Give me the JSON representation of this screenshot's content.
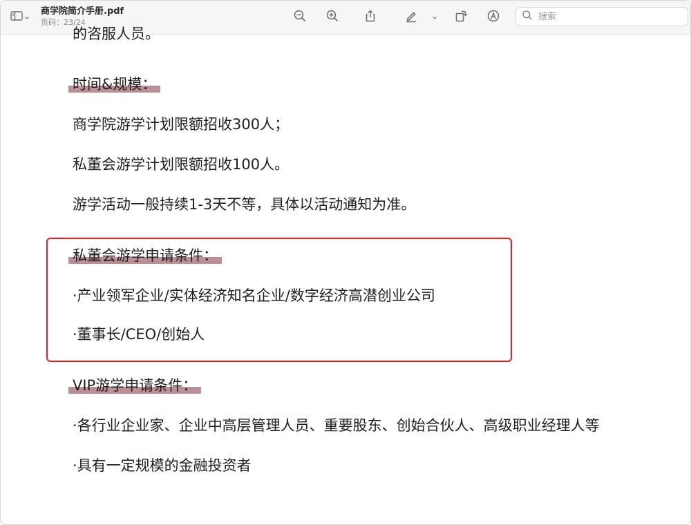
{
  "toolbar": {
    "title": "商学院简介手册.pdf",
    "page_info": "页码：23/24",
    "search_placeholder": "搜索",
    "icons": [
      "sidebar-icon",
      "chevron-down-icon",
      "zoom-out-icon",
      "zoom-in-icon",
      "share-icon",
      "highlight-pen-icon",
      "chevron-down-icon",
      "rotate-icon",
      "markup-icon",
      "search-icon"
    ]
  },
  "document": {
    "cut_line": "的咨服人员。",
    "section1_heading": "时间&规模：",
    "section1_lines": [
      "商学院游学计划限额招收300人；",
      "私董会游学计划限额招收100人。",
      "游学活动一般持续1-3天不等，具体以活动通知为准。"
    ],
    "section2_heading": "私董会游学申请条件：",
    "section2_lines": [
      "·产业领军企业/实体经济知名企业/数字经济高潜创业公司",
      "·董事长/CEO/创始人"
    ],
    "section3_heading": "VIP游学申请条件：",
    "section3_lines": [
      "·各行业企业家、企业中高层管理人员、重要股东、创始合伙人、高级职业经理人等",
      "·具有一定规模的金融投资者"
    ]
  },
  "colors": {
    "highlight": "#b07a83",
    "annotation_box": "#ea1c24"
  }
}
